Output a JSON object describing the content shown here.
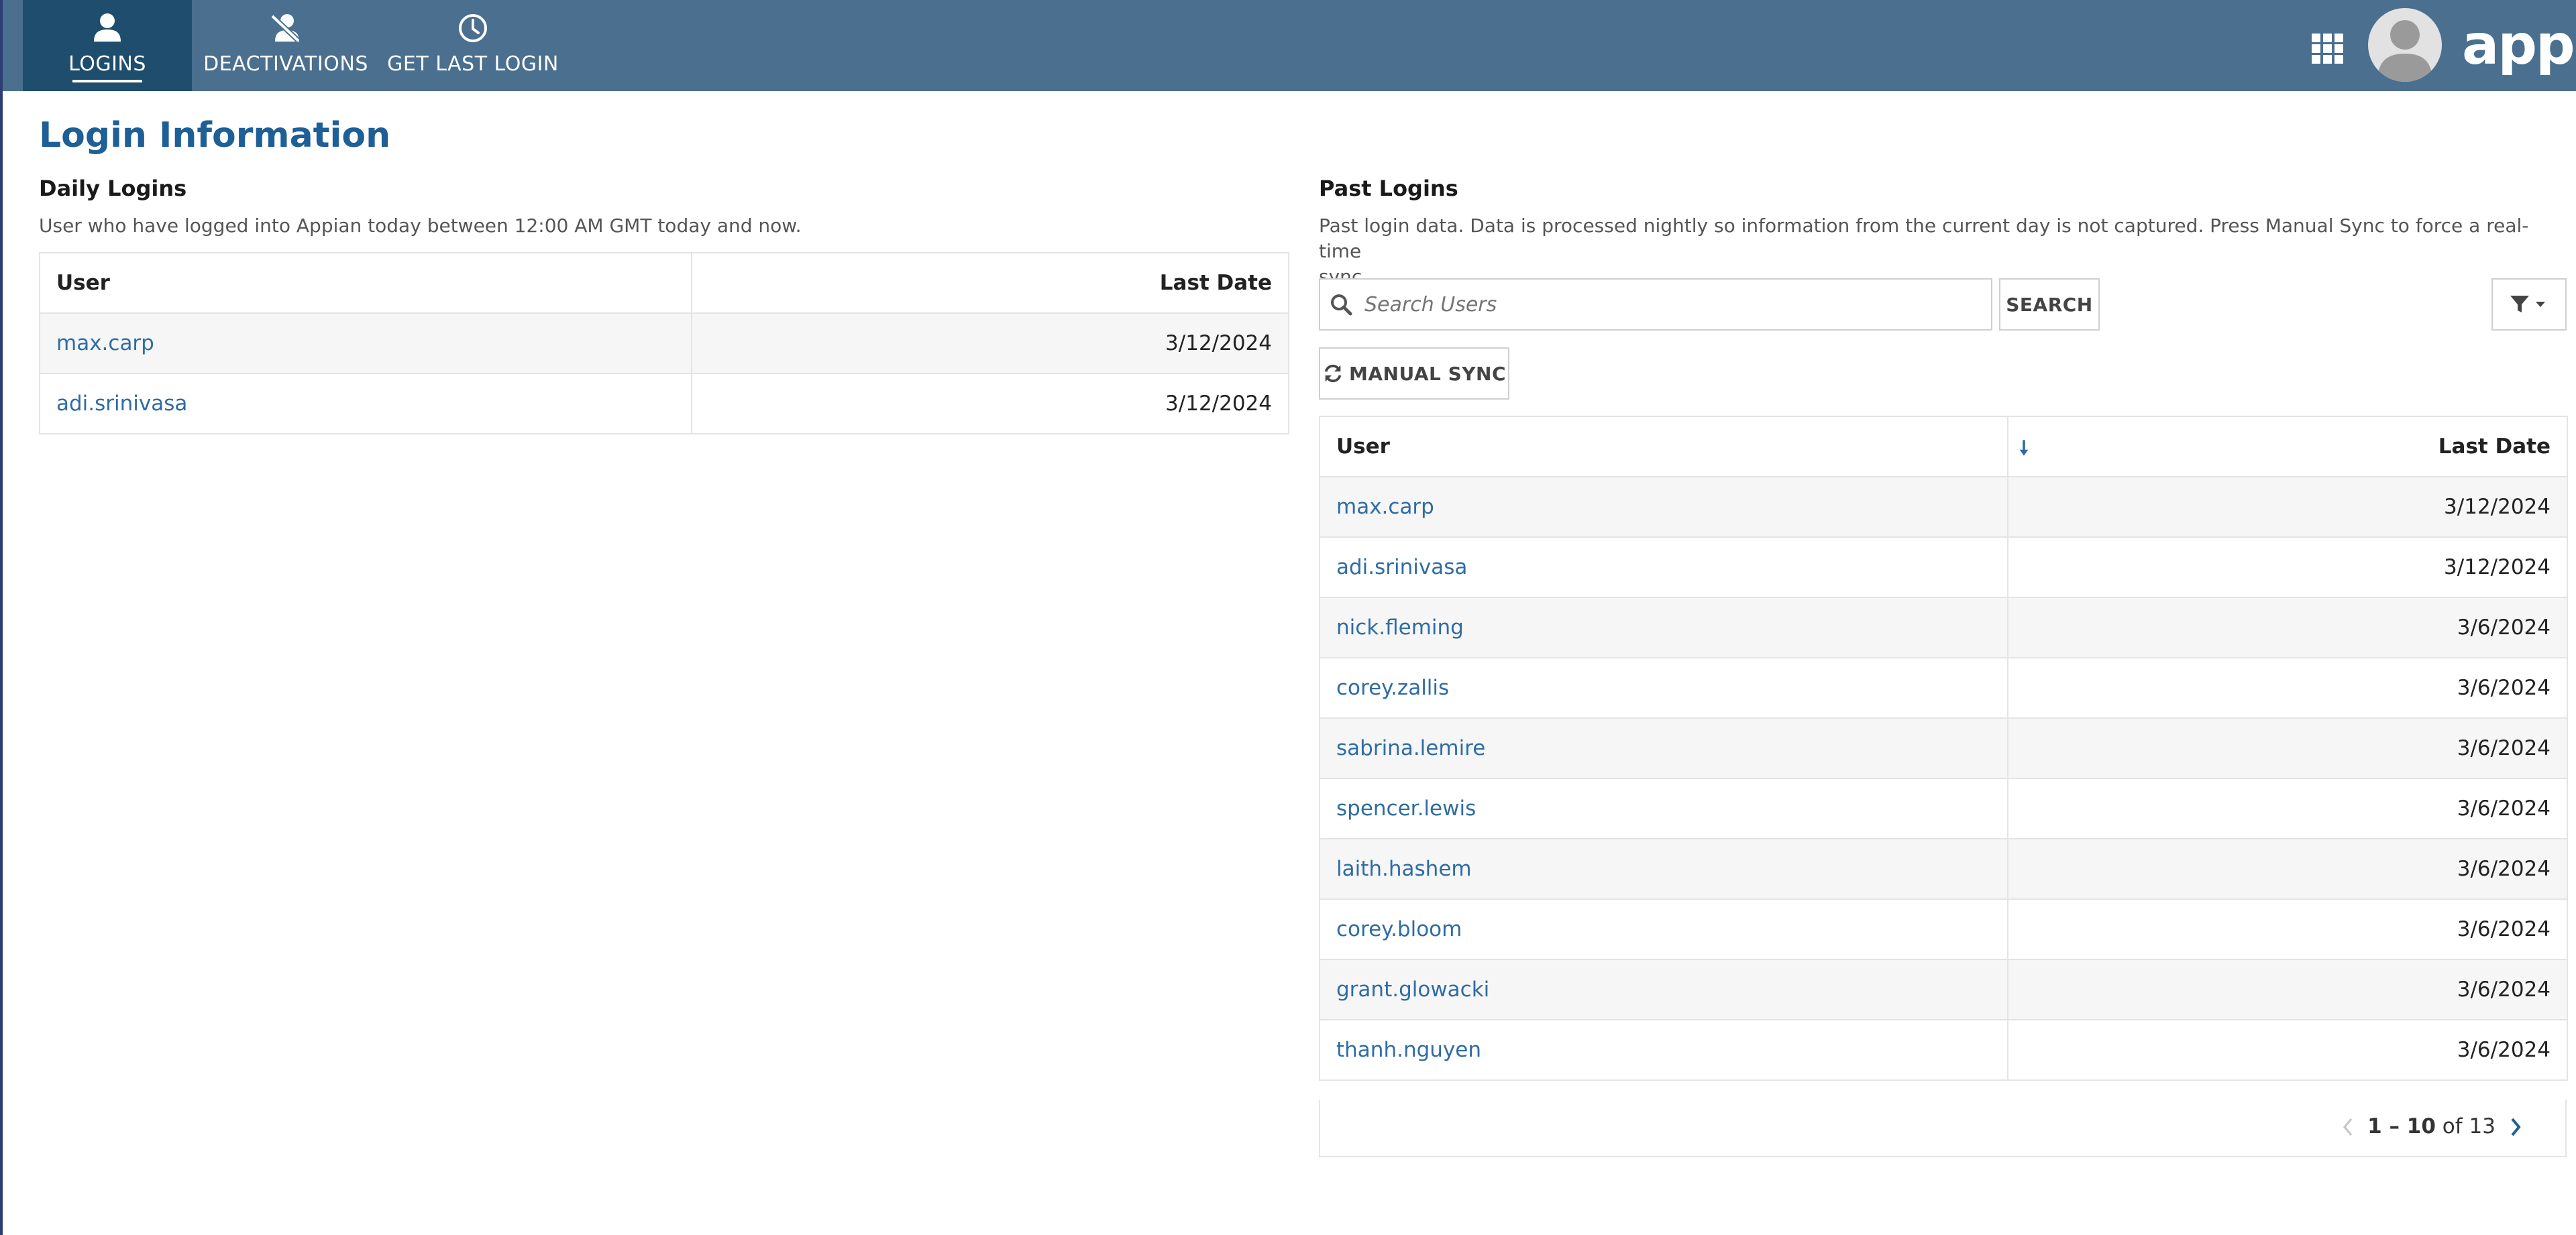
{
  "nav": {
    "tabs": [
      {
        "label": "LOGINS",
        "icon": "user-icon",
        "active": true
      },
      {
        "label": "DEACTIVATIONS",
        "icon": "user-slash-icon",
        "active": false
      },
      {
        "label": "GET LAST LOGIN",
        "icon": "clock-icon",
        "active": false
      }
    ],
    "brand": "appian"
  },
  "page": {
    "title": "Login Information"
  },
  "daily": {
    "title": "Daily Logins",
    "description": "User who have logged into Appian today between 12:00 AM GMT today and now.",
    "columns": [
      "User",
      "Last Date"
    ],
    "rows": [
      {
        "user": "max.carp",
        "date": "3/12/2024"
      },
      {
        "user": "adi.srinivasa",
        "date": "3/12/2024"
      }
    ]
  },
  "past": {
    "title": "Past Logins",
    "description_line1": "Past login data. Data is processed nightly so information from the current day is not captured. Press Manual Sync to force a real-time",
    "description_line2": "sync.",
    "search_placeholder": "Search Users",
    "search_button": "SEARCH",
    "sync_button": "MANUAL SYNC",
    "columns": [
      "User",
      "Last Date"
    ],
    "rows": [
      {
        "user": "max.carp",
        "date": "3/12/2024"
      },
      {
        "user": "adi.srinivasa",
        "date": "3/12/2024"
      },
      {
        "user": "nick.fleming",
        "date": "3/6/2024"
      },
      {
        "user": "corey.zallis",
        "date": "3/6/2024"
      },
      {
        "user": "sabrina.lemire",
        "date": "3/6/2024"
      },
      {
        "user": "spencer.lewis",
        "date": "3/6/2024"
      },
      {
        "user": "laith.hashem",
        "date": "3/6/2024"
      },
      {
        "user": "corey.bloom",
        "date": "3/6/2024"
      },
      {
        "user": "grant.glowacki",
        "date": "3/6/2024"
      },
      {
        "user": "thanh.nguyen",
        "date": "3/6/2024"
      }
    ],
    "pager": {
      "range": "1 – 10",
      "of_label": "of",
      "total": "13"
    }
  },
  "colors": {
    "nav_bg": "#4a6f8f",
    "nav_active": "#1e4d6e",
    "title": "#1d5f96",
    "link": "#2e6ca4"
  }
}
